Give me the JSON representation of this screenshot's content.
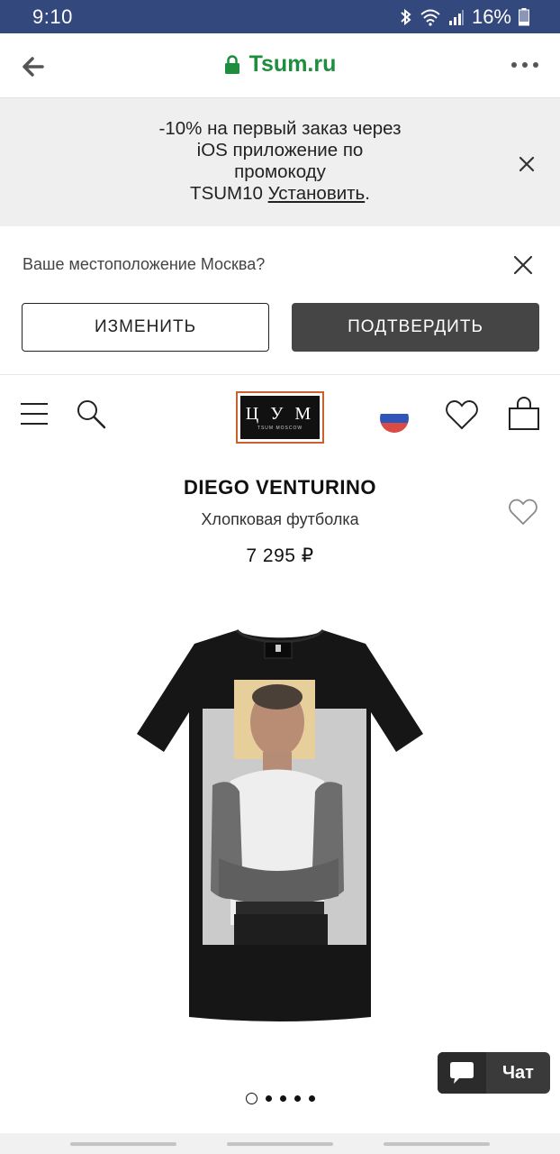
{
  "status_bar": {
    "time": "9:10",
    "battery": "16%"
  },
  "browser": {
    "url": "Tsum.ru"
  },
  "promo": {
    "line1": "-10% на первый заказ через",
    "line2": "iOS приложение по",
    "line3": "промокоду",
    "line4_code": "TSUM10",
    "line4_link": "Установить",
    "line4_end": "."
  },
  "location": {
    "question": "Ваше местоположение Москва?",
    "change_label": "ИЗМЕНИТЬ",
    "confirm_label": "ПОДТВЕРДИТЬ"
  },
  "header": {
    "logo_letters": "Ц У М",
    "logo_sub": "TSUM MOSCOW"
  },
  "product": {
    "brand": "DIEGO VENTURINO",
    "name": "Хлопковая футболка",
    "price": "7 295 ₽"
  },
  "carousel": {
    "total": 5,
    "active_index": 0
  },
  "chat": {
    "label": "Чат"
  },
  "colors": {
    "status_bar": "#33487c",
    "url_green": "#1e8e3e",
    "logo_border": "#c9622e",
    "confirm_btn": "#454545"
  }
}
